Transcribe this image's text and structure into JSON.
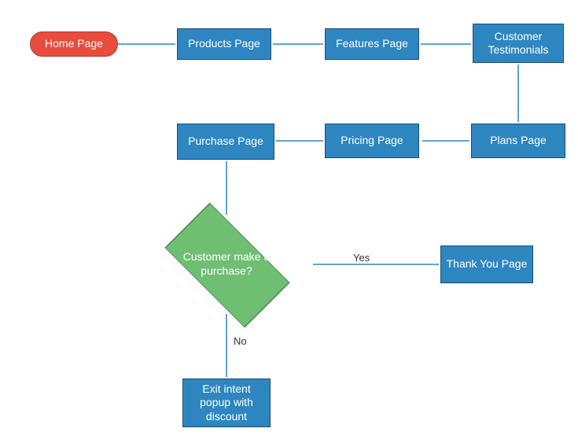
{
  "diagram": {
    "type": "flowchart",
    "colors": {
      "process_fill": "#2E86C1",
      "process_stroke": "#1B4F72",
      "start_fill": "#E74C3C",
      "start_stroke": "#B03A2E",
      "decision_fill": "#6FBF73",
      "decision_stroke": "#4E8C52",
      "arrow": "#2E86C1"
    },
    "nodes": {
      "home": {
        "shape": "pill",
        "label": "Home Page"
      },
      "products": {
        "shape": "rect",
        "label": "Products Page"
      },
      "features": {
        "shape": "rect",
        "label": "Features Page"
      },
      "testimonials": {
        "shape": "rect",
        "label": "Customer Testimonials"
      },
      "plans": {
        "shape": "rect",
        "label": "Plans Page"
      },
      "pricing": {
        "shape": "rect",
        "label": "Pricing Page"
      },
      "purchase": {
        "shape": "rect",
        "label": "Purchase Page"
      },
      "decision": {
        "shape": "diamond",
        "label": "Customer make a purchase?"
      },
      "thankyou": {
        "shape": "rect",
        "label": "Thank You Page"
      },
      "exit": {
        "shape": "rect",
        "label": "Exit intent popup with discount"
      }
    },
    "edges": [
      {
        "from": "home",
        "to": "products"
      },
      {
        "from": "products",
        "to": "features"
      },
      {
        "from": "features",
        "to": "testimonials"
      },
      {
        "from": "testimonials",
        "to": "plans"
      },
      {
        "from": "plans",
        "to": "pricing"
      },
      {
        "from": "pricing",
        "to": "purchase"
      },
      {
        "from": "purchase",
        "to": "decision"
      },
      {
        "from": "decision",
        "to": "thankyou",
        "label": "Yes"
      },
      {
        "from": "decision",
        "to": "exit",
        "label": "No"
      }
    ]
  }
}
